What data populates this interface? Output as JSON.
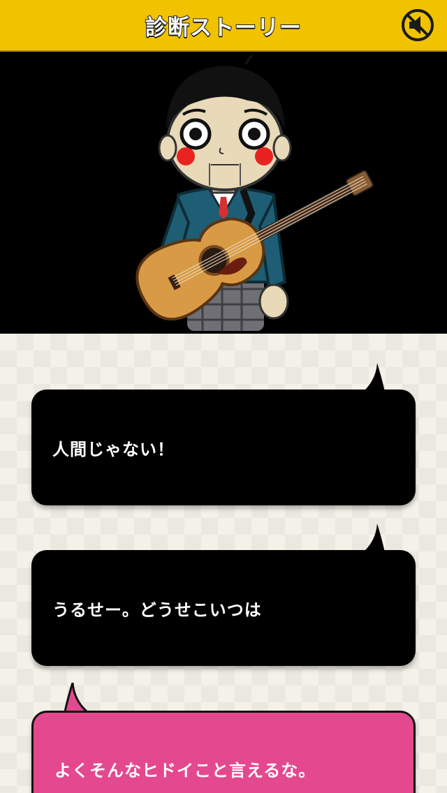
{
  "header": {
    "title": "診断ストーリー",
    "mute_icon": "speaker-muted-icon"
  },
  "scene": {
    "character": "schoolboy-with-guitar"
  },
  "dialogue": [
    {
      "text": "人間じゃない！",
      "style": "black",
      "tail": "top-right"
    },
    {
      "text": "うるせー。どうせこいつは",
      "style": "black",
      "tail": "top-right"
    },
    {
      "text": "よくそんなヒドイこと言えるな。",
      "style": "pink",
      "tail": "top-left"
    }
  ],
  "colors": {
    "header": "#f0c200",
    "bubble_black": "#000000",
    "bubble_pink": "#e4498f",
    "background": "#f4f1e8"
  }
}
